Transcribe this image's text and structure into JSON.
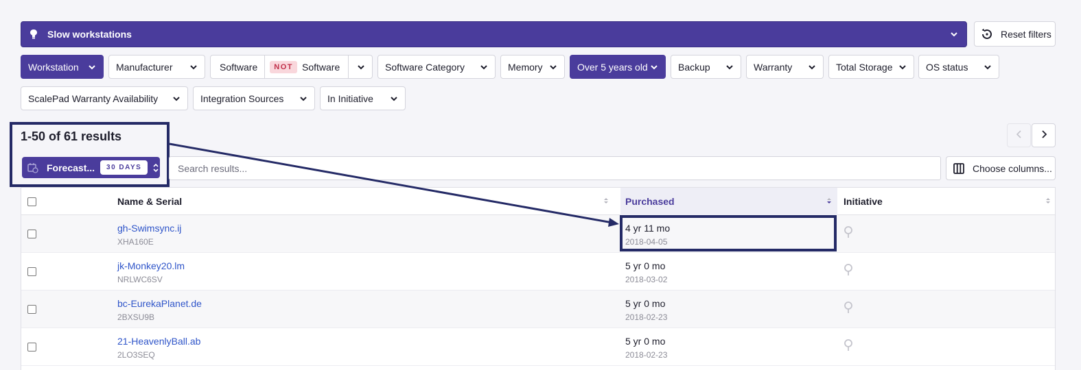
{
  "topbar": {
    "title": "Slow workstations",
    "icon": "pin-icon"
  },
  "reset": {
    "label": "Reset filters"
  },
  "filters": {
    "workstation": "Workstation",
    "manufacturer": "Manufacturer",
    "software_left": "Software",
    "not_badge": "NOT",
    "software_right": "Software",
    "software_category": "Software Category",
    "memory": "Memory",
    "over_5_years": "Over 5 years old",
    "backup": "Backup",
    "warranty": "Warranty",
    "total_storage": "Total Storage",
    "os_status": "OS status",
    "scalepad_warranty": "ScalePad Warranty Availability",
    "integration_sources": "Integration Sources",
    "in_initiative": "In Initiative"
  },
  "results": {
    "count_label": "1-50 of 61 results"
  },
  "forecast": {
    "label": "Forecast...",
    "badge": "30 DAYS"
  },
  "search": {
    "placeholder": "Search results..."
  },
  "columns_button": {
    "label": "Choose columns..."
  },
  "table": {
    "headers": {
      "name": "Name & Serial",
      "purchased": "Purchased",
      "initiative": "Initiative"
    },
    "rows": [
      {
        "name": "gh-Swimsync.ij",
        "serial": "XHA160E",
        "age": "4 yr 11 mo",
        "date": "2018-04-05"
      },
      {
        "name": "jk-Monkey20.lm",
        "serial": "NRLWC6SV",
        "age": "5 yr 0 mo",
        "date": "2018-03-02"
      },
      {
        "name": "bc-EurekaPlanet.de",
        "serial": "2BXSU9B",
        "age": "5 yr 0 mo",
        "date": "2018-02-23"
      },
      {
        "name": "21-HeavenlyBall.ab",
        "serial": "2LO3SEQ",
        "age": "5 yr 0 mo",
        "date": "2018-02-23"
      }
    ]
  },
  "colors": {
    "brand": "#4a3c9c",
    "link": "#2f55c9",
    "annotation": "#242a66",
    "not_badge_bg": "#f9d7dc",
    "not_badge_text": "#c0314a"
  }
}
